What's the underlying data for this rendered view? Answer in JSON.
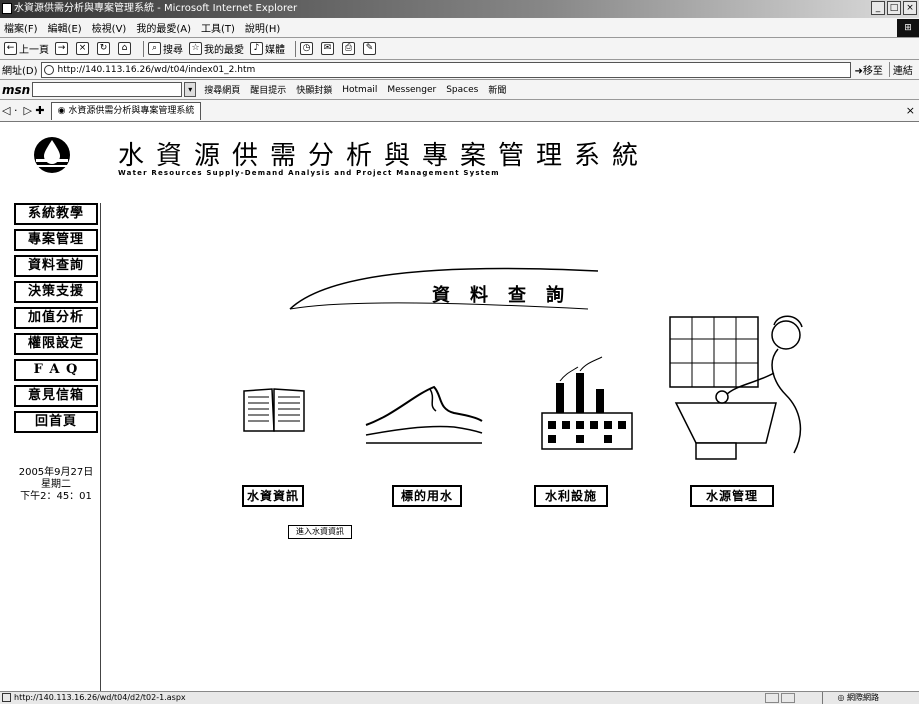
{
  "window": {
    "title": "水資源供需分析與專案管理系統 - Microsoft Internet Explorer",
    "buttons": [
      "_",
      "□",
      "×"
    ]
  },
  "menubar": {
    "items": [
      "檔案(F)",
      "編輯(E)",
      "檢視(V)",
      "我的最愛(A)",
      "工具(T)",
      "說明(H)"
    ]
  },
  "toolbar": {
    "back": "上一頁",
    "favorites": "我的最愛",
    "media": "媒體",
    "search": "搜尋"
  },
  "addressbar": {
    "label": "網址(D)",
    "url": "http://140.113.16.26/wd/t04/index01_2.htm",
    "go": "移至",
    "links": "連結"
  },
  "msnbar": {
    "logo": "msn",
    "items": [
      "搜尋網頁",
      "醒目提示",
      "快顯封鎖",
      "Hotmail",
      "Messenger",
      "Spaces",
      "新聞"
    ]
  },
  "tabsbar": {
    "tab_title": "水資源供需分析與專案管理系統",
    "close": "×"
  },
  "header": {
    "title": "水資源供需分析與專案管理系統",
    "subtitle": "Water Resources Supply-Demand Analysis and Project Management System"
  },
  "sidebar": {
    "items": [
      "系統教學",
      "專案管理",
      "資料查詢",
      "決策支援",
      "加值分析",
      "權限設定",
      "F A Q",
      "意見信箱",
      "回首頁"
    ],
    "date": "2005年9月27日",
    "weekday": "星期二",
    "time": "下午2：45：01"
  },
  "main": {
    "section_title": "資料查詢",
    "categories": [
      "水資資訊",
      "標的用水",
      "水利設施",
      "水源管理"
    ],
    "sub_link": "進入水資資訊"
  },
  "statusbar": {
    "url": "http://140.113.16.26/wd/t04/d2/t02-1.aspx",
    "zone": "網際網路"
  }
}
